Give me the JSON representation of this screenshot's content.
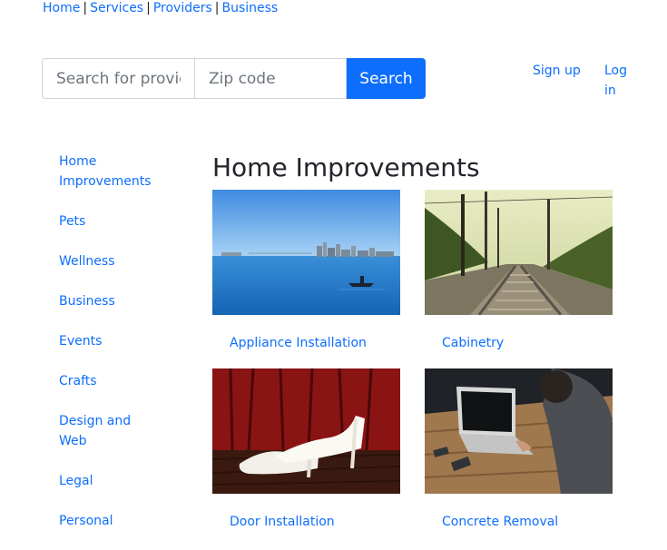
{
  "topnav": {
    "links": [
      "Home",
      "Services",
      "Providers",
      "Business"
    ],
    "separator": "|"
  },
  "search": {
    "query_placeholder": "Search for providers",
    "zip_placeholder": "Zip code",
    "button_label": "Search"
  },
  "account": {
    "signup_label": "Sign up",
    "login_label": "Log in"
  },
  "sidebar": {
    "items": [
      {
        "label": "Home Improvements"
      },
      {
        "label": "Pets"
      },
      {
        "label": "Wellness"
      },
      {
        "label": "Business"
      },
      {
        "label": "Events"
      },
      {
        "label": "Crafts"
      },
      {
        "label": "Design and Web"
      },
      {
        "label": "Legal"
      },
      {
        "label": "Personal"
      }
    ]
  },
  "main": {
    "title": "Home Improvements",
    "services": [
      {
        "label": "Appliance Installation",
        "image": "bay-with-rowboat-photo"
      },
      {
        "label": "Cabinetry",
        "image": "railway-tracks-photo"
      },
      {
        "label": "Door Installation",
        "image": "white-heels-photo"
      },
      {
        "label": "Concrete Removal",
        "image": "person-with-laptop-photo"
      }
    ]
  },
  "colors": {
    "link": "#0d6efd",
    "button_bg": "#0d6efd",
    "text": "#212529"
  }
}
